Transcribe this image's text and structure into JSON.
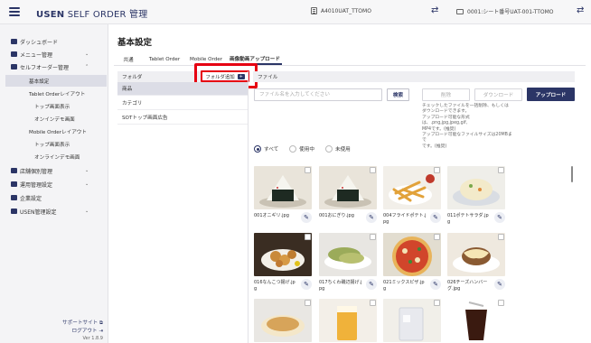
{
  "header": {
    "brand_bold": "USEN",
    "brand_rest": " SELF ORDER 管理",
    "store_id": "A4010UAT_TTOMO",
    "device": "0001:シート番号UAT-001-TTOMO",
    "swap_icon": "swap-arrows-icon",
    "menu_icon": "hamburger-icon"
  },
  "sidebar": {
    "items": [
      {
        "label": "ダッシュボード",
        "icon": "dashboard-icon"
      },
      {
        "label": "メニュー管理",
        "icon": "menu-book-icon"
      },
      {
        "label": "セルフオーダー管理",
        "icon": "tablet-icon"
      }
    ],
    "sub_items": [
      "基本設定",
      "Tablet Orderレイアウト",
      "トップ画面表示",
      "オンインデモ画面",
      "Mobile Orderレイアウト",
      "トップ画面表示",
      "オンラインデモ画面"
    ],
    "items2": [
      {
        "label": "店舗個別管理",
        "icon": "store-icon"
      },
      {
        "label": "運用管理設定",
        "icon": "settings-icon"
      },
      {
        "label": "企業設定",
        "icon": "building-icon"
      },
      {
        "label": "USEN管理設定",
        "icon": "gear-icon"
      }
    ],
    "support": "サポートサイト",
    "logout": "ログアウト",
    "version": "Ver 1.8.9"
  },
  "main": {
    "title": "基本設定",
    "tabs": [
      "共通",
      "Tablet Order",
      "Mobile Order",
      "画像動画アップロード"
    ],
    "active_tab": "画像動画アップロード"
  },
  "folders": {
    "header": "フォルダ",
    "add_button": "フォルダ追加",
    "items": [
      "商品",
      "カテゴリ",
      "SOTトップ画面広告"
    ]
  },
  "files": {
    "header": "ファイル",
    "search_placeholder": "ファイル名を入力してください",
    "search_button": "検索",
    "delete_button": "削除",
    "download_button": "ダウンロード",
    "upload_button": "アップロード",
    "help_lines": [
      "チェックしたファイルを一括削除、もしくは",
      "ダウンロードできます。",
      "アップロード可能な形式は、.png,jpg,jpeg,gif,",
      "MP4です。(推奨)",
      "アップロード可能なファイルサイズは20MBまで",
      "です。(推奨)"
    ],
    "filters": [
      "すべて",
      "使用中",
      "未使用"
    ],
    "selected_filter": "すべて",
    "images": [
      {
        "name": "001オニギリ.jpg",
        "kind": "onigiri"
      },
      {
        "name": "001おにぎり.jpg",
        "kind": "onigiri"
      },
      {
        "name": "004フライドポテト.jpg",
        "kind": "fries"
      },
      {
        "name": "011ポテトサラダ.jpg",
        "kind": "salad"
      },
      {
        "name": "016なんこつ揚げ.jpg",
        "kind": "karaage"
      },
      {
        "name": "017ちくわ磯辺揚げ.jpg",
        "kind": "chikuwa"
      },
      {
        "name": "021ミックスピザ.jpg",
        "kind": "pizza"
      },
      {
        "name": "026チーズハンバーグ.jpg",
        "kind": "hamburg"
      },
      {
        "name": "",
        "kind": "ramen"
      },
      {
        "name": "",
        "kind": "beer"
      },
      {
        "name": "",
        "kind": "highball"
      },
      {
        "name": "",
        "kind": "cola"
      }
    ]
  },
  "colors": {
    "navy": "#2b3566",
    "highlight_red": "#e60012",
    "sidebar_bg": "#f4f4f6"
  }
}
